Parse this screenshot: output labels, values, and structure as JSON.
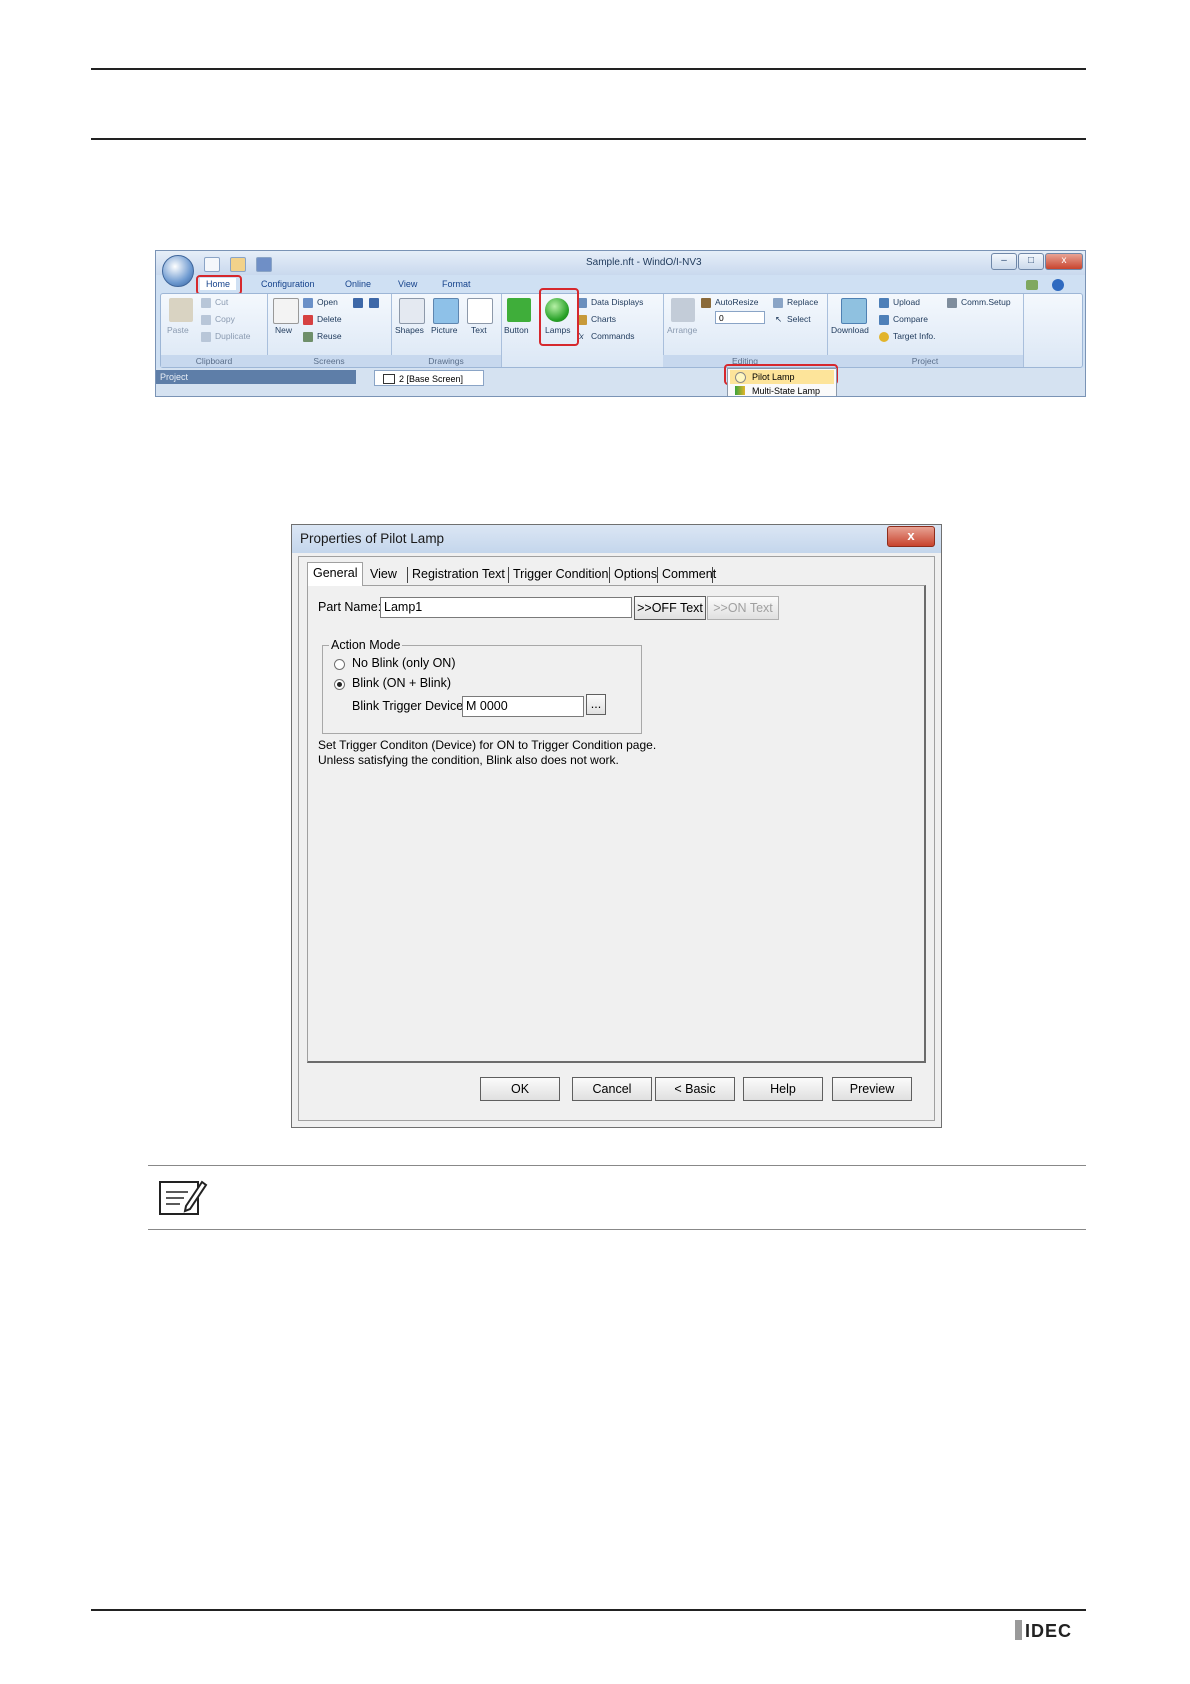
{
  "ribbon": {
    "title": "Sample.nft - WindO/I-NV3",
    "tabs": [
      "Home",
      "Configuration",
      "Online",
      "View",
      "Format"
    ],
    "groups": {
      "clipboard": {
        "label": "Clipboard",
        "paste": "Paste",
        "cut": "Cut",
        "copy": "Copy",
        "duplicate": "Duplicate"
      },
      "screens": {
        "label": "Screens",
        "new": "New",
        "open": "Open",
        "delete": "Delete",
        "reuse": "Reuse"
      },
      "drawings": {
        "label": "Drawings",
        "shapes": "Shapes",
        "picture": "Picture",
        "text": "Text"
      },
      "parts": {
        "button": "Button",
        "lamps": "Lamps",
        "data_displays": "Data Displays",
        "charts": "Charts",
        "commands": "Commands"
      },
      "editing": {
        "label": "Editing",
        "arrange": "Arrange",
        "autoresize": "AutoResize",
        "autoresize_value": "0",
        "replace": "Replace",
        "select": "Select"
      },
      "project": {
        "label": "Project",
        "download": "Download",
        "upload": "Upload",
        "compare": "Compare",
        "target_info": "Target Info.",
        "comm_setup": "Comm.Setup"
      }
    },
    "project_pane": "Project",
    "doc_tab": "2  [Base Screen]",
    "lamp_menu": [
      "Pilot Lamp",
      "Multi-State Lamp"
    ]
  },
  "dialog": {
    "title": "Properties of Pilot Lamp",
    "close": "x",
    "tabs": [
      "General",
      "View",
      "Registration Text",
      "Trigger Condition",
      "Options",
      "Comment"
    ],
    "part_name_label": "Part Name:",
    "part_name_value": "Lamp1",
    "off_text_btn": ">>OFF Text",
    "on_text_btn": ">>ON Text",
    "action_mode_legend": "Action Mode",
    "no_blink": "No Blink (only ON)",
    "blink": "Blink (ON + Blink)",
    "blink_trigger_label": "Blink Trigger Device:",
    "blink_trigger_value": "M 0000",
    "browse": "...",
    "note_line1": "Set Trigger Conditon (Device) for ON to Trigger Condition page.",
    "note_line2": "Unless satisfying the condition, Blink also does not work.",
    "buttons": {
      "ok": "OK",
      "cancel": "Cancel",
      "basic": "< Basic",
      "help": "Help",
      "preview": "Preview"
    }
  },
  "footer": {
    "brand": "IDEC"
  },
  "colors": {
    "highlight": "#d6282d",
    "brand": "#222222"
  }
}
